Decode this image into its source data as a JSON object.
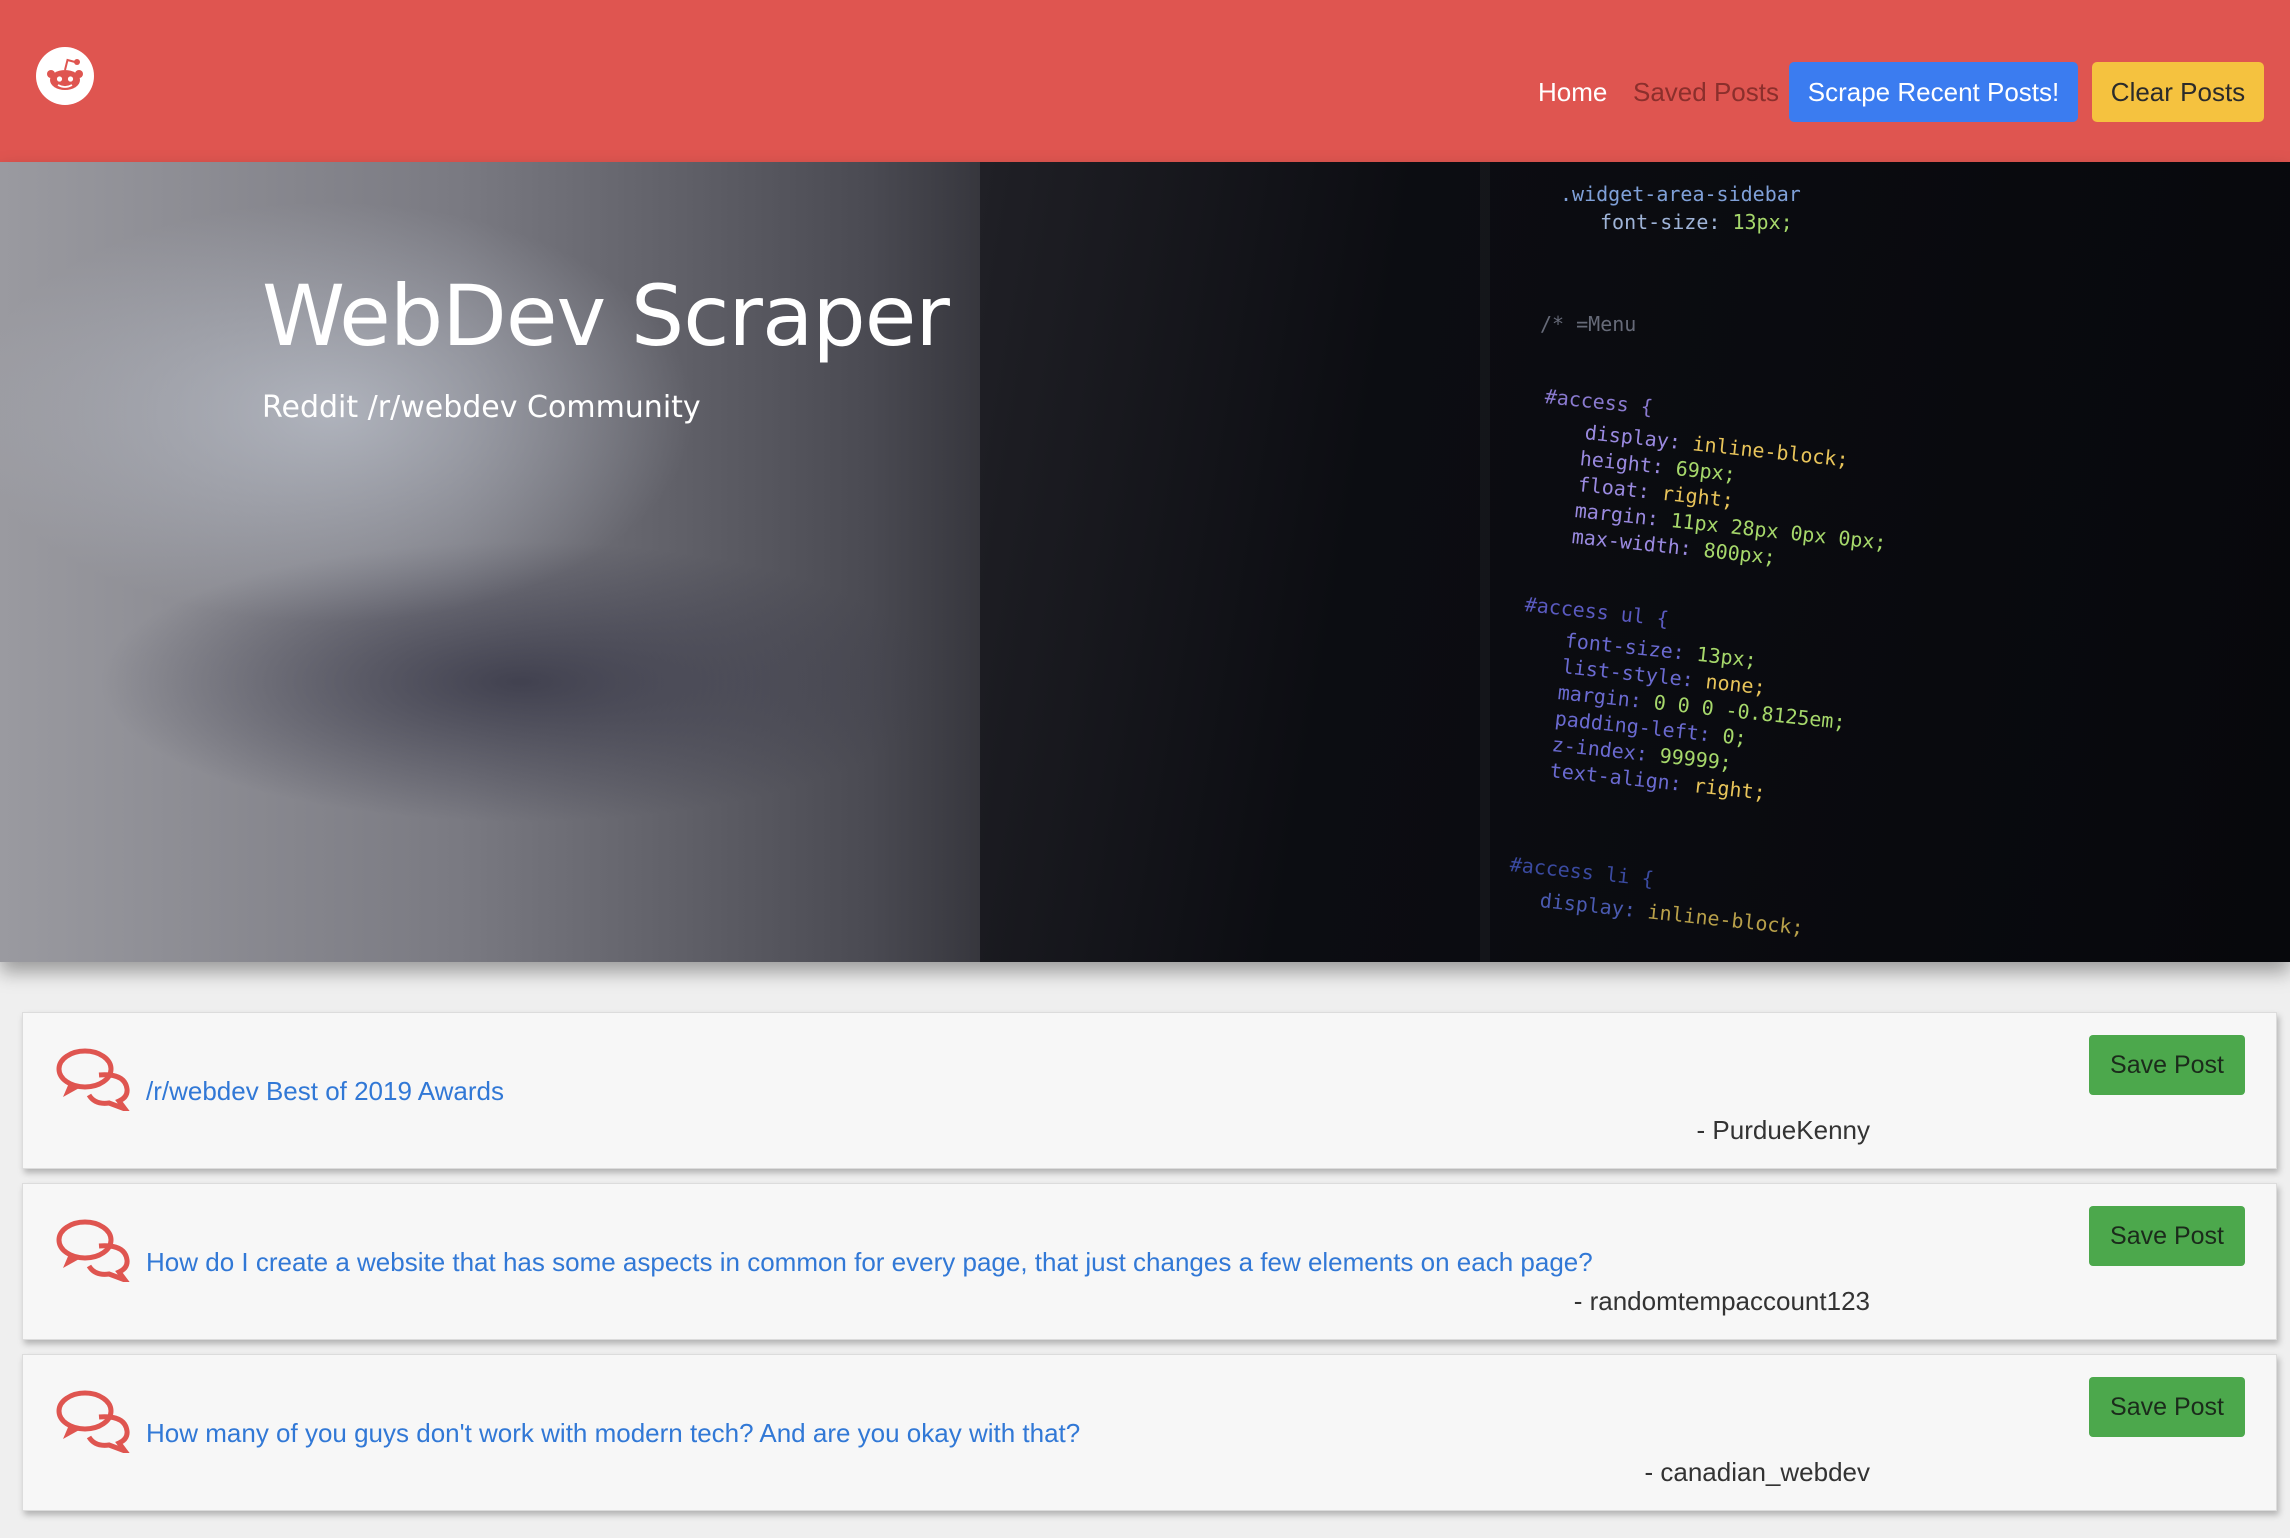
{
  "navbar": {
    "logo_icon": "reddit-alien-icon",
    "links": {
      "home": "Home",
      "saved": "Saved Posts"
    },
    "buttons": {
      "scrape": "Scrape Recent Posts!",
      "clear": "Clear Posts"
    },
    "colors": {
      "background": "#df5550",
      "scrape_button": "#3b7cf0",
      "clear_button": "#f5c23f"
    }
  },
  "hero": {
    "title": "WebDev Scraper",
    "subtitle": "Reddit /r/webdev Community"
  },
  "posts": [
    {
      "icon": "comments-icon",
      "title": "/r/webdev Best of 2019 Awards",
      "author": "- PurdueKenny",
      "save_label": "Save Post"
    },
    {
      "icon": "comments-icon",
      "title": "How do I create a website that has some aspects in common for every page, that just changes a few elements on each page?",
      "author": "- randomtempaccount123",
      "save_label": "Save Post"
    },
    {
      "icon": "comments-icon",
      "title": "How many of you guys don't work with modern tech? And are you okay with that?",
      "author": "- canadian_webdev",
      "save_label": "Save Post"
    }
  ]
}
